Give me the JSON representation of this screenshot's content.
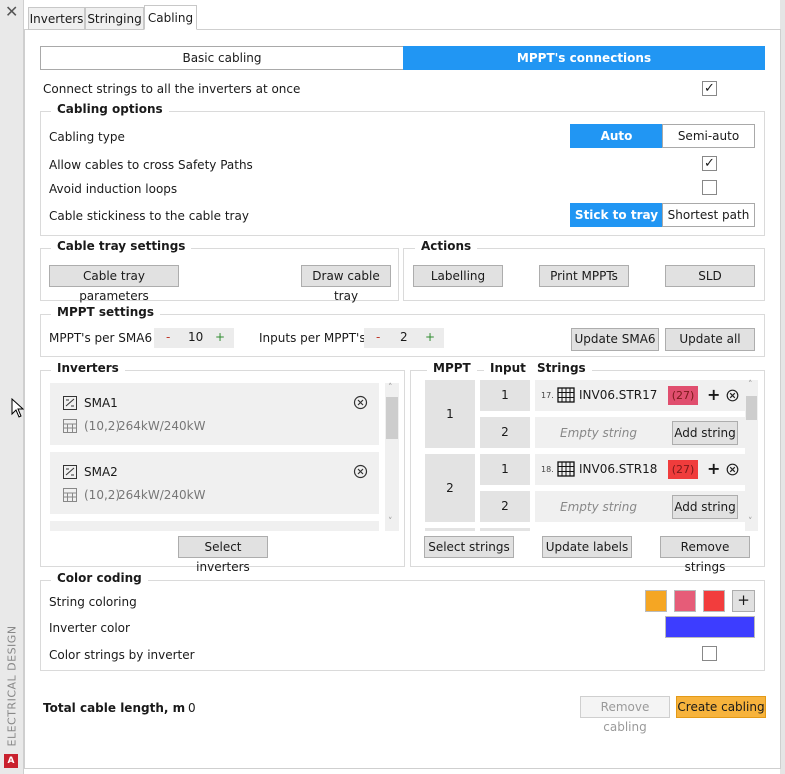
{
  "sidebar": {
    "close_glyph": "✕",
    "vertical_label": "ELECTRICAL DESIGN",
    "app_logo": "A"
  },
  "tabs": [
    {
      "label": "Inverters",
      "active": false
    },
    {
      "label": "Stringing",
      "active": false
    },
    {
      "label": "Cabling",
      "active": true
    }
  ],
  "mode": {
    "basic_label": "Basic cabling",
    "mppt_label": "MPPT's connections",
    "selected": "mppt"
  },
  "connect_all": {
    "label": "Connect strings to all the inverters at once",
    "checked": true
  },
  "cabling_options": {
    "title": "Cabling options",
    "type_label": "Cabling type",
    "type_auto": "Auto",
    "type_semi": "Semi-auto",
    "allow_cross_label": "Allow cables to cross Safety Paths",
    "allow_cross_checked": true,
    "avoid_loops_label": "Avoid induction loops",
    "avoid_loops_checked": false,
    "stickiness_label": "Cable stickiness to the cable tray",
    "stick_label": "Stick to tray",
    "shortest_label": "Shortest path"
  },
  "tray": {
    "title": "Cable tray settings",
    "params_button": "Cable tray parameters",
    "draw_button": "Draw cable tray"
  },
  "actions": {
    "title": "Actions",
    "labelling": "Labelling",
    "print": "Print MPPTs",
    "sld": "SLD"
  },
  "mppt_settings": {
    "title": "MPPT settings",
    "per_label": "MPPT's per SMA6",
    "per_value": "10",
    "inputs_label": "Inputs per MPPT's",
    "inputs_value": "2",
    "minus": "-",
    "plus": "+",
    "update_sma": "Update SMA6",
    "update_all": "Update all"
  },
  "inverters": {
    "title": "Inverters",
    "items": [
      {
        "name": "SMA1",
        "coords": "(10,2)",
        "power": "264kW/240kW"
      },
      {
        "name": "SMA2",
        "coords": "(10,2)",
        "power": "264kW/240kW"
      }
    ],
    "select_button": "Select inverters"
  },
  "mppt_grid": {
    "col_mppt": "MPPT",
    "col_input": "Input",
    "col_strings": "Strings",
    "rows": [
      {
        "mppt": "1",
        "inputs": [
          {
            "input": "1",
            "index": "17.",
            "string": "INV06.STR17",
            "badge": "(27)",
            "badge_color": "#e04e6e"
          },
          {
            "input": "2",
            "placeholder": "Empty string",
            "add": "Add string"
          }
        ]
      },
      {
        "mppt": "2",
        "inputs": [
          {
            "input": "1",
            "index": "18.",
            "string": "INV06.STR18",
            "badge": "(27)",
            "badge_color": "#f03c3c"
          },
          {
            "input": "2",
            "placeholder": "Empty string",
            "add": "Add string"
          }
        ]
      }
    ],
    "select_strings": "Select strings",
    "update_labels": "Update labels",
    "remove_strings": "Remove strings"
  },
  "color_coding": {
    "title": "Color coding",
    "string_label": "String coloring",
    "string_colors": [
      "#f5a623",
      "#e65c78",
      "#f23d3d"
    ],
    "add_glyph": "+",
    "inverter_label": "Inverter color",
    "inverter_color": "#3d3dff",
    "by_inverter_label": "Color strings by inverter",
    "by_inverter_checked": false
  },
  "footer": {
    "total_label": "Total cable length, m",
    "total_value": "0",
    "remove_cabling": "Remove cabling",
    "create_cabling": "Create cabling"
  },
  "accent_color": "#2196f3"
}
